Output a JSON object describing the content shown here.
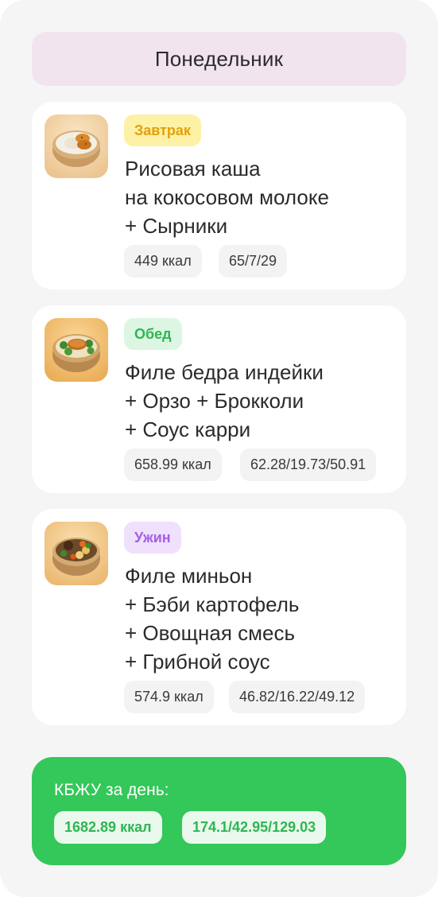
{
  "day": {
    "title": "Понедельник"
  },
  "meals": [
    {
      "tag": "Завтрак",
      "tag_bg": "#fdf1a6",
      "tag_color": "#e2a10a",
      "title_lines": [
        "Рисовая каша",
        "на кокосовом молоке",
        "+ Сырники"
      ],
      "kcal": "449 ккал",
      "bju": "65/7/29"
    },
    {
      "tag": "Обед",
      "tag_bg": "#dcf6e3",
      "tag_color": "#2fb552",
      "title_lines": [
        "Филе бедра индейки",
        "+ Орзо + Брокколи",
        "+ Соус карри"
      ],
      "kcal": "658.99 ккал",
      "bju": "62.28/19.73/50.91"
    },
    {
      "tag": "Ужин",
      "tag_bg": "#efe0fb",
      "tag_color": "#a55ee8",
      "title_lines": [
        "Филе миньон",
        "+ Бэби картофель",
        "+ Овощная смесь",
        "+ Грибной соус"
      ],
      "kcal": "574.9 ккал",
      "bju": "46.82/16.22/49.12"
    }
  ],
  "summary": {
    "title": "КБЖУ за день:",
    "kcal": "1682.89 ккал",
    "bju": "174.1/42.95/129.03"
  }
}
